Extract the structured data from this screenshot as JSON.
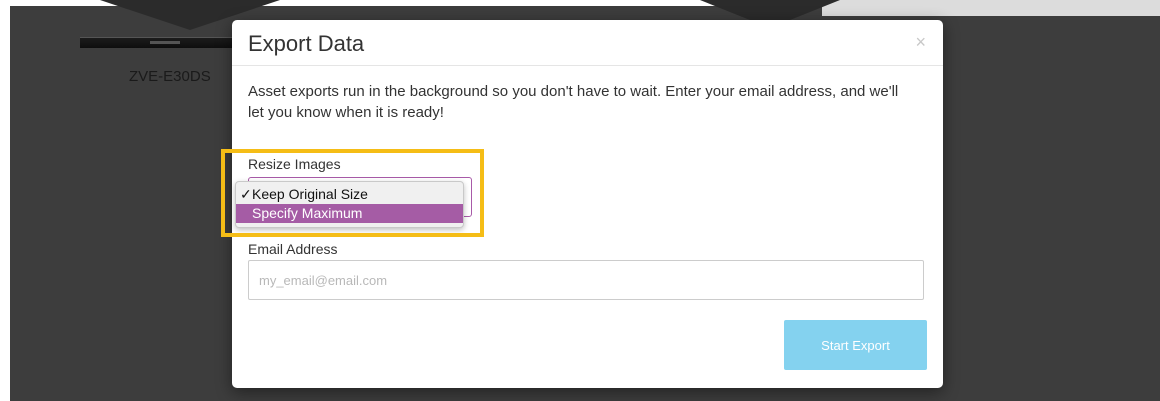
{
  "background": {
    "product_name": "ZVE-E30DS"
  },
  "modal": {
    "title": "Export Data",
    "close_glyph": "×",
    "description": "Asset exports run in the background so you don't have to wait. Enter your email address, and we'll let you know when it is ready!",
    "resize_images": {
      "label": "Resize Images",
      "selected_value": "Keep Original Size",
      "options": [
        {
          "label": "Keep Original Size",
          "checked": true,
          "highlighted": false
        },
        {
          "label": "Specify Maximum",
          "checked": false,
          "highlighted": true
        }
      ]
    },
    "email": {
      "label": "Email Address",
      "placeholder": "my_email@email.com",
      "value": ""
    },
    "start_button_label": "Start Export"
  },
  "colors": {
    "backdrop": "#3d3d3d",
    "accent_purple": "#a55ca5",
    "button_blue": "#84d2ef",
    "annotation_yellow": "#f5bd16"
  },
  "icons": {
    "close": "close-icon",
    "check": "checkmark-icon"
  }
}
